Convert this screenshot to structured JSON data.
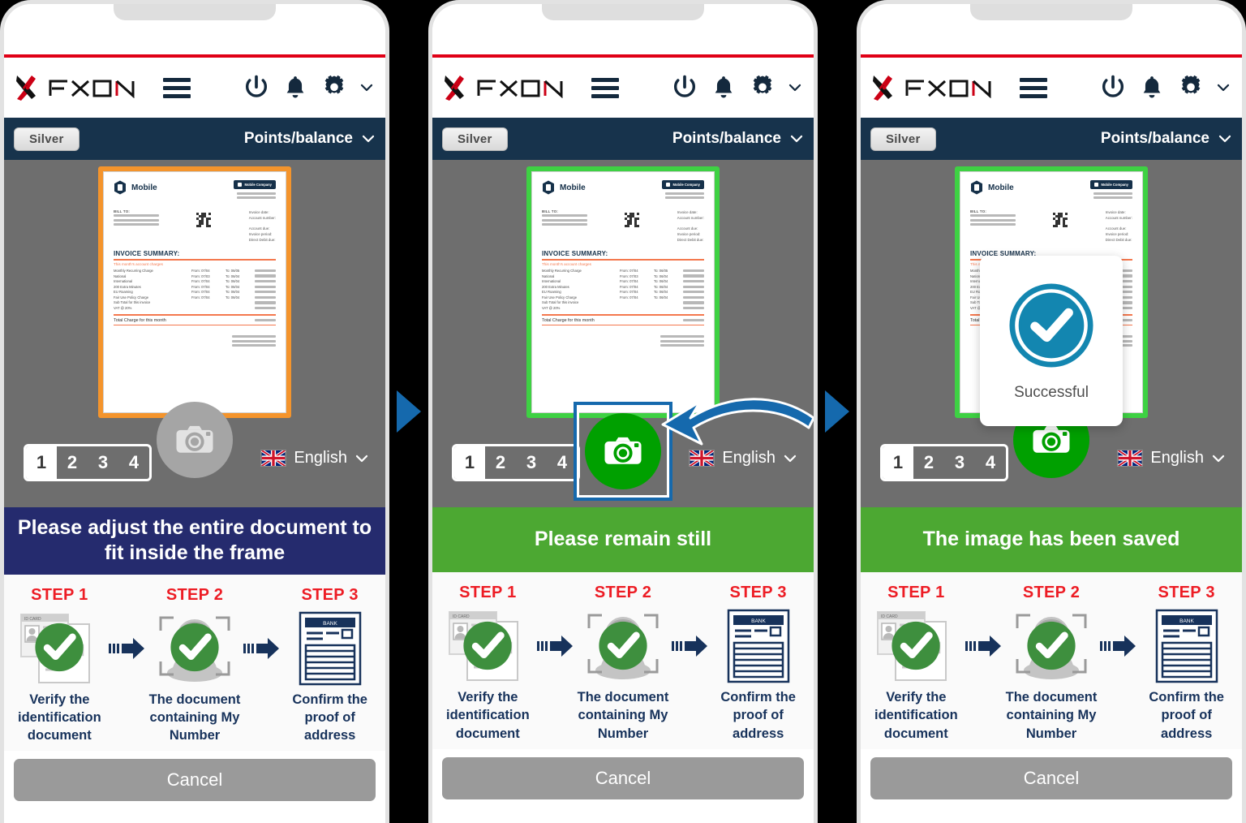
{
  "brand": {
    "logo_text": "FXON",
    "accent_red": "#e00016",
    "navy": "#17334c"
  },
  "header": {
    "menu_icon": "hamburger-icon",
    "power_icon": "power-icon",
    "bell_icon": "bell-icon",
    "gear_icon": "gear-icon",
    "chevron_icon": "chevron-down-icon"
  },
  "navbar": {
    "rank_badge": "Silver",
    "points_label": "Points/balance",
    "points_chevron": "chevron-down-icon"
  },
  "document": {
    "brand_name": "Mobile",
    "company_chip": "Mobile Company",
    "bill_to_label": "BILL TO:",
    "meta_lines": [
      "Invoice date:",
      "Account number:",
      "Account due:",
      "Invoice period:",
      "Direct Debit due:"
    ],
    "summary_title": "INVOICE SUMMARY:",
    "summary_subtitle": "This month's account charges",
    "line_items": [
      {
        "name": "Monthly Recurring Charge",
        "from": "From: 07/04",
        "to": "To: 06/05"
      },
      {
        "name": "National",
        "from": "From: 07/03",
        "to": "To: 06/04"
      },
      {
        "name": "International",
        "from": "From: 07/04",
        "to": "To: 06/04"
      },
      {
        "name": "200 Extra Minutes",
        "from": "From: 07/04",
        "to": "To: 06/04"
      },
      {
        "name": "EU Roaming",
        "from": "From: 07/04",
        "to": "To: 06/04"
      },
      {
        "name": "Fair Use Policy Charge",
        "from": "From: 07/04",
        "to": "To: 06/04"
      },
      {
        "name": "Sub Total for this invoice",
        "from": "",
        "to": ""
      },
      {
        "name": "VAT @ 20%",
        "from": "",
        "to": ""
      }
    ],
    "total_label": "Total Charge for this month"
  },
  "controls": {
    "pages": [
      "1",
      "2",
      "3",
      "4"
    ],
    "active_page": "1",
    "shutter_icon": "camera-icon",
    "flag_icon": "uk-flag-icon",
    "language": "English",
    "language_chevron": "chevron-down-icon"
  },
  "panels": [
    {
      "frame_color": "#f4942c",
      "shutter_state": "disabled",
      "banner_text": "Please adjust the entire document to fit inside the frame",
      "banner_style": "navy",
      "highlight": false,
      "pointer_arrow": false,
      "modal": null
    },
    {
      "frame_color": "#3ed143",
      "shutter_state": "enabled",
      "banner_text": "Please remain still",
      "banner_style": "green",
      "highlight": true,
      "pointer_arrow": true,
      "modal": null
    },
    {
      "frame_color": "#3ed143",
      "shutter_state": "enabled",
      "banner_text": "The image has been saved",
      "banner_style": "green",
      "highlight": false,
      "pointer_arrow": false,
      "modal": {
        "icon": "check-circle-icon",
        "label": "Successful"
      }
    }
  ],
  "steps": [
    {
      "title": "STEP 1",
      "caption": "Verify the identification document",
      "art": "id-card-icon",
      "checked": true
    },
    {
      "title": "STEP 2",
      "caption": "The document containing My Number",
      "art": "face-scan-icon",
      "checked": true
    },
    {
      "title": "STEP 3",
      "caption": "Confirm the proof of address",
      "art": "bank-statement-icon",
      "checked": false
    }
  ],
  "step_arrow_icon": "arrow-right-icon",
  "footer": {
    "cancel_label": "Cancel"
  },
  "separators": {
    "icon": "play-triangle-icon",
    "color": "#1569ad"
  },
  "id_card_art": {
    "label": "ID CARD"
  },
  "bank_art": {
    "label": "BANK"
  }
}
